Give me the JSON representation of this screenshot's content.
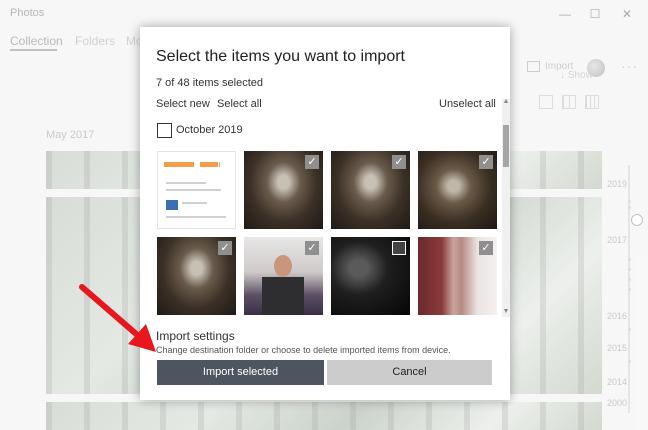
{
  "app": {
    "title": "Photos",
    "nav": [
      "Collection",
      "Folders",
      "Mo"
    ],
    "import_label": "Import",
    "more_label": "···",
    "show_label": "Show",
    "date_label": "May 2017",
    "timeline_years": [
      "2019",
      "2017",
      "2016",
      "2015",
      "2014",
      "2000"
    ]
  },
  "window": {
    "minimize": "—",
    "maximize": "☐",
    "close": "✕"
  },
  "dialog": {
    "title": "Select the items you want to import",
    "count": "7 of 48 items selected",
    "select_new": "Select new",
    "select_all": "Select all",
    "unselect_all": "Unselect all",
    "group_label": "October 2019",
    "settings_title": "Import settings",
    "settings_desc": "Change destination folder or choose to delete imported items from device.",
    "import_button": "Import selected",
    "cancel_button": "Cancel"
  },
  "thumbnails": [
    {
      "kind": "document",
      "selected": false
    },
    {
      "kind": "room-lights",
      "selected": true
    },
    {
      "kind": "room-lights",
      "selected": true
    },
    {
      "kind": "room-lights",
      "selected": true
    },
    {
      "kind": "room-lights",
      "selected": true
    },
    {
      "kind": "person",
      "selected": true
    },
    {
      "kind": "dark-crowd",
      "selected": false
    },
    {
      "kind": "corridor",
      "selected": true
    }
  ],
  "colors": {
    "primary_button": "#4d5561",
    "secondary_button": "#cccccc",
    "arrow": "#e8171e",
    "accent_orange": "#f39c4a"
  },
  "icons": {
    "check": "✓",
    "arrow_down": "↓",
    "scroll_up": "▲",
    "scroll_down": "▼"
  }
}
